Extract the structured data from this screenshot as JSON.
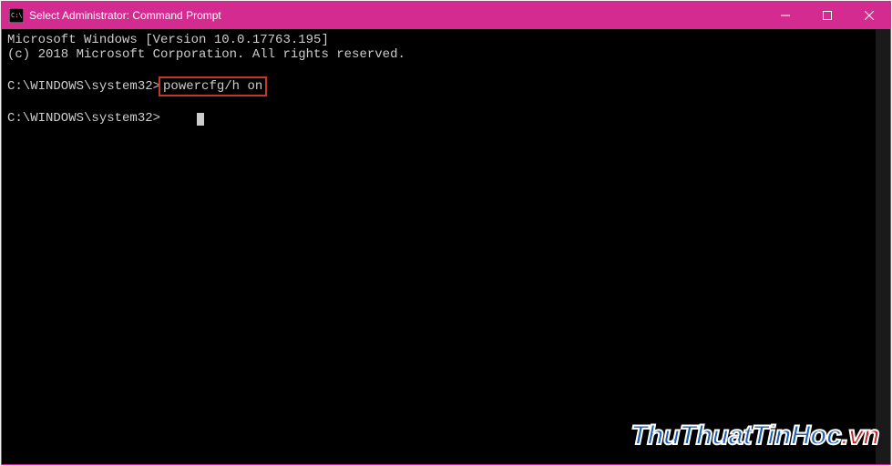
{
  "titlebar": {
    "title": "Select Administrator: Command Prompt"
  },
  "terminal": {
    "line1": "Microsoft Windows [Version 10.0.17763.195]",
    "line2": "(c) 2018 Microsoft Corporation. All rights reserved.",
    "prompt1_prefix": "C:\\WINDOWS\\system32>",
    "command_highlighted": "powercfg/h on",
    "prompt2_prefix": "C:\\WINDOWS\\system32>"
  },
  "watermark": {
    "part1": "ThuThuatTinHoc",
    "part2": ".vn"
  }
}
